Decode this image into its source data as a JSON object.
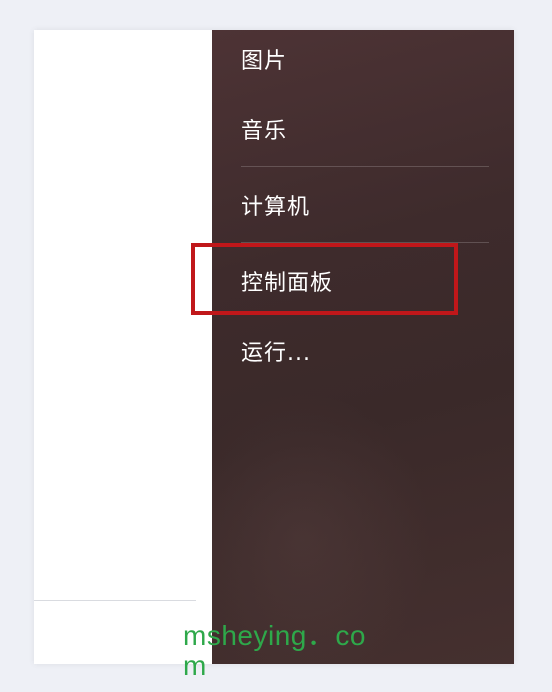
{
  "menu": {
    "items": [
      {
        "label": "图片"
      },
      {
        "label": "音乐"
      },
      {
        "label": "计算机"
      },
      {
        "label": "控制面板"
      },
      {
        "label": "运行..."
      }
    ]
  },
  "annotation": {
    "highlight_color": "#c0171a",
    "highlighted_item": "控制面板"
  },
  "watermark": {
    "text": "msheying．com"
  },
  "colors": {
    "menu_background": "#3e2b2c",
    "left_pane": "#ffffff",
    "page_background": "#eef0f6",
    "watermark": "#2ea84a"
  }
}
